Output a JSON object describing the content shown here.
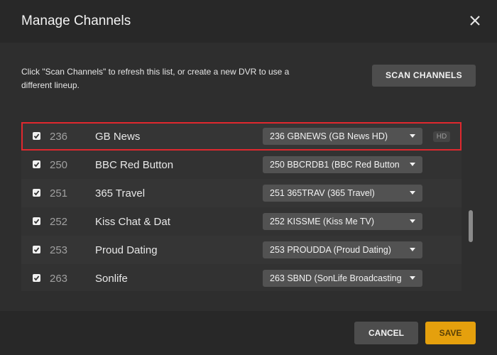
{
  "dialog": {
    "title": "Manage Channels",
    "intro": "Click \"Scan Channels\" to refresh this list, or create a new DVR to use a different lineup.",
    "scan_label": "SCAN CHANNELS",
    "cancel_label": "CANCEL",
    "save_label": "SAVE"
  },
  "colors": {
    "accent": "#e5a00d",
    "highlight": "#e0282e",
    "background": "#2e2e2e"
  },
  "icons": {
    "close": "close-icon",
    "checkbox": "checkbox-checked-icon",
    "dropdown": "chevron-down-icon"
  },
  "channels": [
    {
      "checked": true,
      "number": "236",
      "name": "GB News",
      "selection": "236 GBNEWS (GB News HD)",
      "badge": "HD",
      "highlighted": true
    },
    {
      "checked": true,
      "number": "250",
      "name": "BBC Red Button",
      "selection": "250 BBCRDB1 (BBC Red Button"
    },
    {
      "checked": true,
      "number": "251",
      "name": "365 Travel",
      "selection": "251 365TRAV (365 Travel)"
    },
    {
      "checked": true,
      "number": "252",
      "name": "Kiss Chat & Dat",
      "selection": "252 KISSME (Kiss Me TV)"
    },
    {
      "checked": true,
      "number": "253",
      "name": "Proud Dating",
      "selection": "253 PROUDDA (Proud Dating)"
    },
    {
      "checked": true,
      "number": "263",
      "name": "Sonlife",
      "selection": "263 SBND (SonLife Broadcasting"
    }
  ]
}
